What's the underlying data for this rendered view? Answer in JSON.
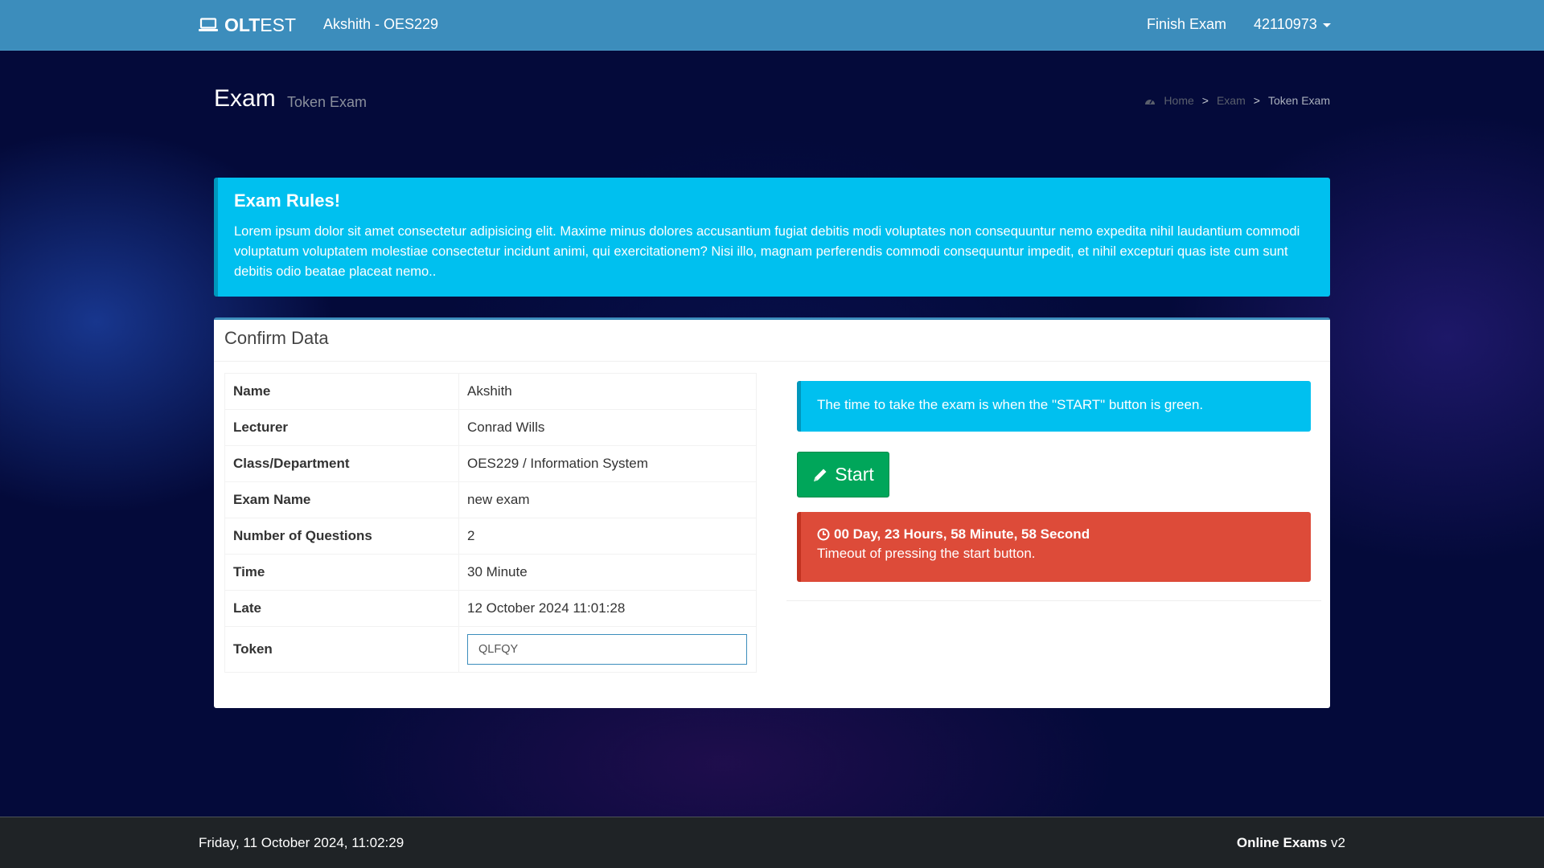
{
  "navbar": {
    "brand_bold": "OLT",
    "brand_rest": "EST",
    "user": "Akshith - OES229",
    "finish_label": "Finish Exam",
    "account_id": "42110973"
  },
  "header": {
    "title": "Exam",
    "subtitle": "Token Exam",
    "breadcrumb": [
      "Home",
      "Exam",
      "Token Exam"
    ]
  },
  "rules": {
    "title": "Exam Rules!",
    "text": "Lorem ipsum dolor sit amet consectetur adipisicing elit. Maxime minus dolores accusantium fugiat debitis modi voluptates non consequuntur nemo expedita nihil laudantium commodi voluptatum voluptatem molestiae consectetur incidunt animi, qui exercitationem? Nisi illo, magnam perferendis commodi consequuntur impedit, et nihil excepturi quas iste cum sunt debitis odio beatae placeat nemo.."
  },
  "confirm": {
    "title": "Confirm Data",
    "rows": [
      {
        "label": "Name",
        "value": "Akshith"
      },
      {
        "label": "Lecturer",
        "value": "Conrad Wills"
      },
      {
        "label": "Class/Department",
        "value": "OES229 / Information System"
      },
      {
        "label": "Exam Name",
        "value": "new exam"
      },
      {
        "label": "Number of Questions",
        "value": "2"
      },
      {
        "label": "Time",
        "value": "30 Minute"
      },
      {
        "label": "Late",
        "value": "12 October 2024 11:01:28"
      }
    ],
    "token_label": "Token",
    "token_value": "QLFQY"
  },
  "side": {
    "info": "The time to take the exam is when the \"START\" button is green.",
    "start_label": "Start",
    "countdown": "00 Day, 23 Hours, 58 Minute, 58 Second",
    "timeout_text": "Timeout of pressing the start button."
  },
  "footer": {
    "datetime": "Friday, 11 October 2024, 11:02:29",
    "app_name": "Online Exams",
    "app_version": "v2"
  },
  "colors": {
    "navbar": "#3c8dbc",
    "info": "#00c0ef",
    "success": "#00a65a",
    "danger": "#dd4b39",
    "footer": "#1f2326"
  }
}
